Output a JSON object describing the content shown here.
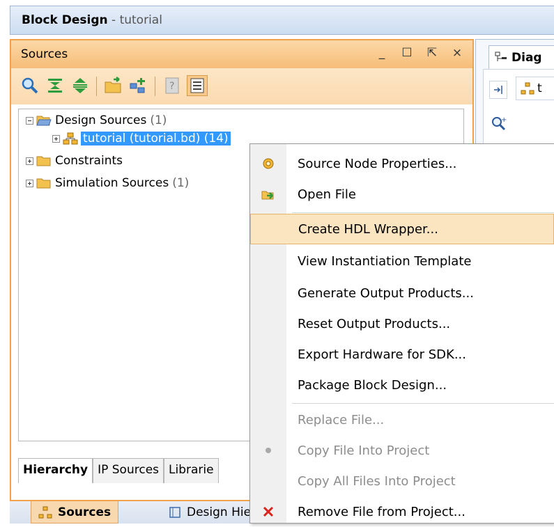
{
  "window": {
    "title": "Block Design",
    "subtitle": "- tutorial"
  },
  "sources_panel": {
    "title": "Sources",
    "controls": {
      "minimize": "_",
      "maximize": "☐",
      "float": "⇱",
      "close": "×"
    },
    "tree": {
      "design_sources": {
        "label": "Design Sources",
        "count": "(1)"
      },
      "tutorial": {
        "label": "tutorial (tutorial.bd) (14)"
      },
      "constraints": {
        "label": "Constraints"
      },
      "simulation_sources": {
        "label": "Simulation Sources",
        "count": "(1)"
      }
    },
    "tabs": [
      "Hierarchy",
      "IP Sources",
      "Librarie"
    ]
  },
  "bottom_tabs": [
    "Sources",
    "Design Hie"
  ],
  "diagram_panel": {
    "tab_label": "Diag",
    "subtab_label": "t"
  },
  "context_menu": {
    "items": [
      {
        "label": "Source Node Properties...",
        "icon": "gear-icon",
        "disabled": false
      },
      {
        "label": "Open File",
        "icon": "open-file-icon",
        "disabled": false
      },
      {
        "label": "Create HDL Wrapper...",
        "icon": "",
        "disabled": false,
        "highlighted": true
      },
      {
        "label": "View Instantiation Template",
        "icon": "",
        "disabled": false
      },
      {
        "label": "Generate Output Products...",
        "icon": "",
        "disabled": false
      },
      {
        "label": "Reset Output Products...",
        "icon": "",
        "disabled": false
      },
      {
        "label": "Export Hardware for SDK...",
        "icon": "",
        "disabled": false
      },
      {
        "label": "Package Block Design...",
        "icon": "",
        "disabled": false
      },
      {
        "label": "Replace File...",
        "icon": "",
        "disabled": true
      },
      {
        "label": "Copy File Into Project",
        "icon": "dot-icon",
        "disabled": true
      },
      {
        "label": "Copy All Files Into Project",
        "icon": "",
        "disabled": true
      },
      {
        "label": "Remove File from Project...",
        "icon": "remove-icon",
        "disabled": false
      }
    ]
  },
  "colors": {
    "panel_accent": "#f0a24d",
    "selection": "#3399ff",
    "menu_highlight": "#fbe4c0",
    "remove_red": "#d9261c"
  }
}
